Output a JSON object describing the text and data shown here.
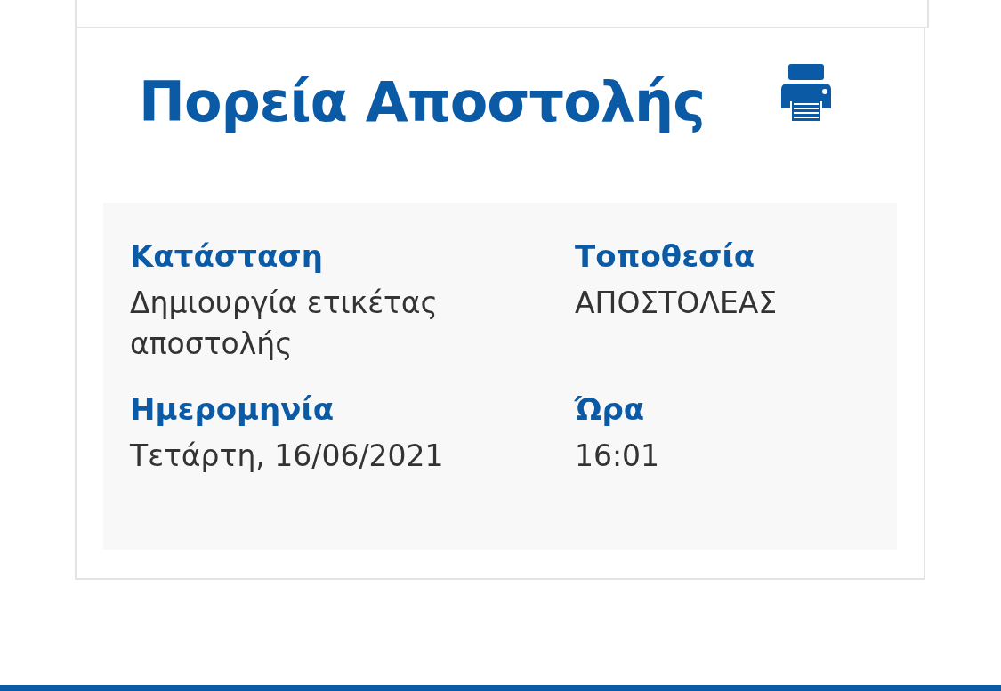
{
  "card": {
    "title": "Πορεία Αποστολής",
    "fields": [
      {
        "label": "Κατάσταση",
        "value": "Δημιουργία ετικέτας αποστολής"
      },
      {
        "label": "Τοποθεσία",
        "value": "ΑΠΟΣΤΟΛΕΑΣ"
      },
      {
        "label": "Ημερομηνία",
        "value": "Τετάρτη, 16/06/2021"
      },
      {
        "label": "Ώρα",
        "value": "16:01"
      }
    ]
  }
}
